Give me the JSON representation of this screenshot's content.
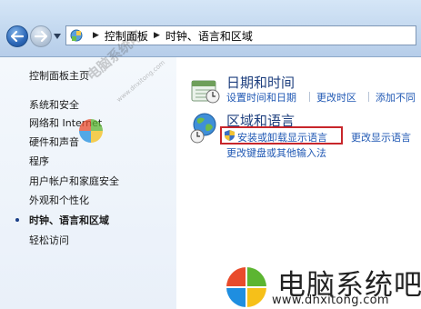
{
  "breadcrumb": [
    "控制面板",
    "时钟、语言和区域"
  ],
  "nav": {
    "home": "控制面板主页",
    "items": [
      {
        "label": "系统和安全",
        "current": false
      },
      {
        "label": "网络和 Internet",
        "current": false
      },
      {
        "label": "硬件和声音",
        "current": false
      },
      {
        "label": "程序",
        "current": false
      },
      {
        "label": "用户帐户和家庭安全",
        "current": false
      },
      {
        "label": "外观和个性化",
        "current": false
      },
      {
        "label": "时钟、语言和区域",
        "current": true
      },
      {
        "label": "轻松访问",
        "current": false
      }
    ]
  },
  "categories": [
    {
      "title": "日期和时间",
      "icon": "calendar-clock-icon",
      "tasks": [
        "设置时间和日期",
        "更改时区",
        "添加不同"
      ]
    },
    {
      "title": "区域和语言",
      "icon": "globe-clock-icon",
      "tasks": [
        "安装或卸载显示语言",
        "更改显示语言",
        "更改键盘或其他输入法"
      ],
      "highlighted_task": "安装或卸载显示语言"
    }
  ],
  "watermark": {
    "name": "电脑系统吧",
    "url": "www.dnxitong.com",
    "small_name": "电脑系统吧",
    "small_url": "www.dnxitong.com"
  },
  "colors": {
    "link": "#2159b4",
    "category_title": "#1e3f7e",
    "highlight_border": "#c8262b",
    "logo_red": "#e94b2b",
    "logo_green": "#5cb531",
    "logo_blue": "#1f8ee0",
    "logo_yellow": "#f6c019"
  }
}
